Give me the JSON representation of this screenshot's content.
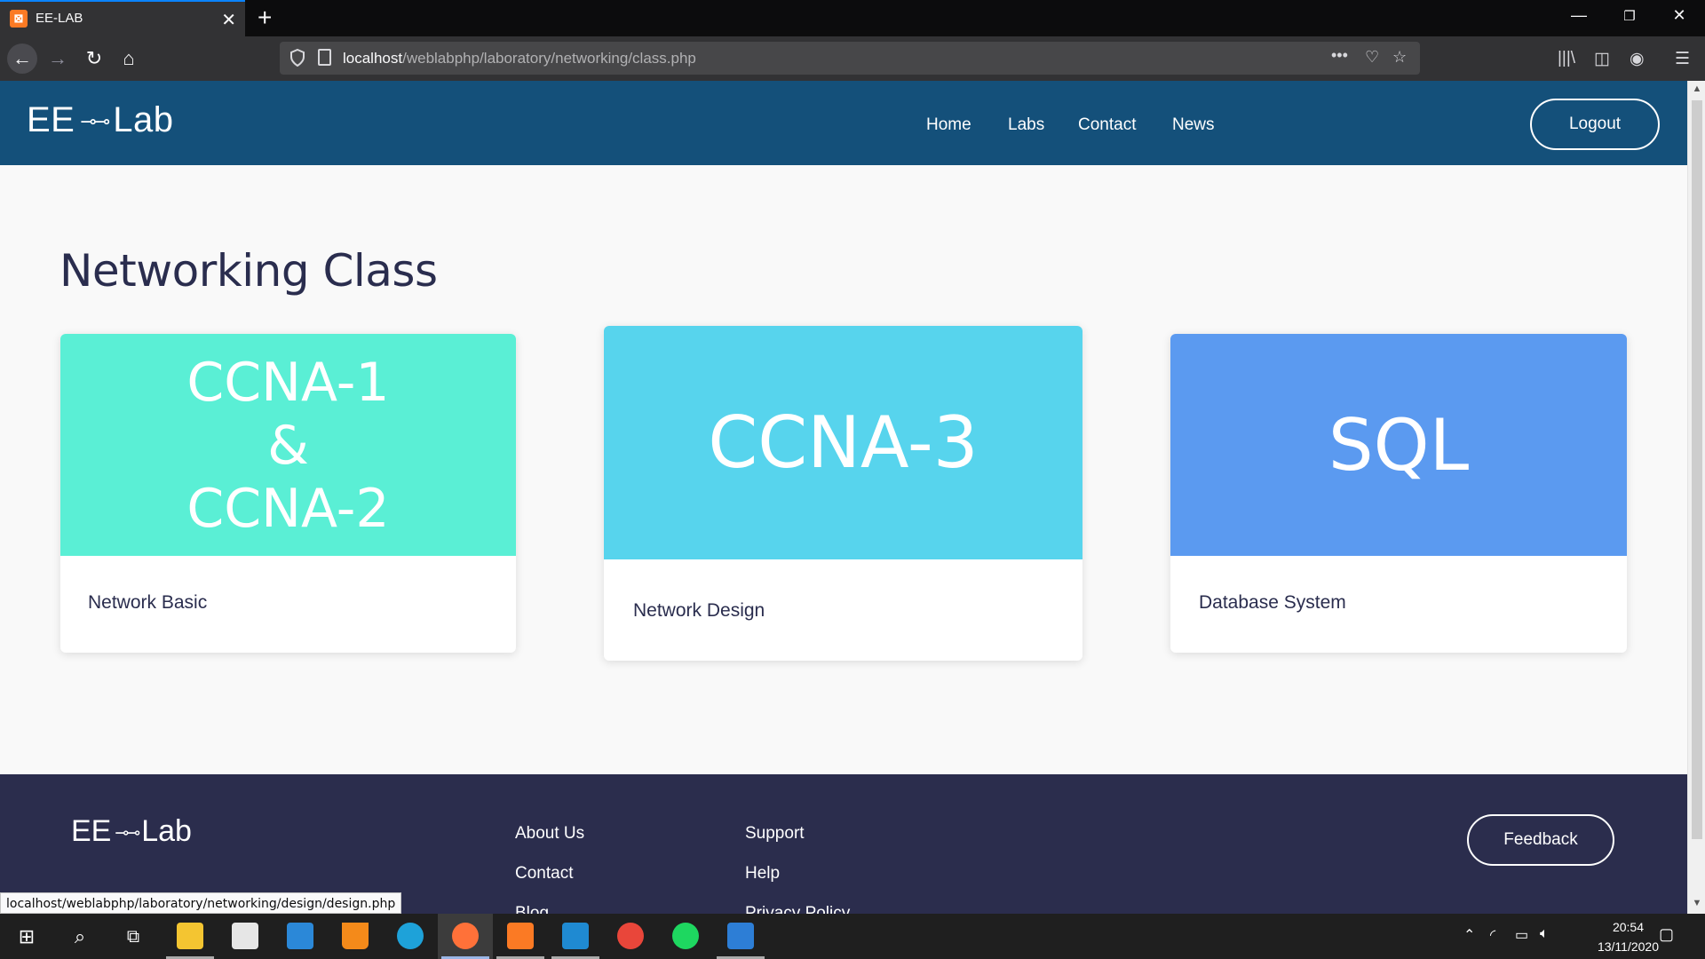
{
  "browser": {
    "tab_title": "EE-LAB",
    "tab_icon": "xampp-icon",
    "url_host": "localhost",
    "url_path": "/weblabphp/laboratory/networking/class.php",
    "status_url": "localhost/weblabphp/laboratory/networking/design/design.php"
  },
  "site": {
    "brand_left": "EE",
    "brand_symbol": "⊸⊸",
    "brand_right": "Lab",
    "menu": [
      "Home",
      "Labs",
      "Contact",
      "News"
    ],
    "logout_label": "Logout"
  },
  "main": {
    "title": "Networking Class",
    "cards": [
      {
        "banner_lines": [
          "CCNA-1",
          "&",
          "CCNA-2"
        ],
        "label": "Network Basic",
        "color": "#5aefd5"
      },
      {
        "banner_lines": [
          "CCNA-3"
        ],
        "label": "Network Design",
        "color": "#57d4ed"
      },
      {
        "banner_lines": [
          "SQL"
        ],
        "label": "Database System",
        "color": "#5b9af0"
      }
    ]
  },
  "footer": {
    "col1": [
      "About Us",
      "Contact",
      "Blog"
    ],
    "col2": [
      "Support",
      "Help",
      "Privacy Policy"
    ],
    "feedback_label": "Feedback"
  },
  "taskbar": {
    "time": "20:54",
    "date": "13/11/2020"
  },
  "colors": {
    "header": "#14507a",
    "footer": "#2b2d4d",
    "title": "#2a2d4e"
  }
}
